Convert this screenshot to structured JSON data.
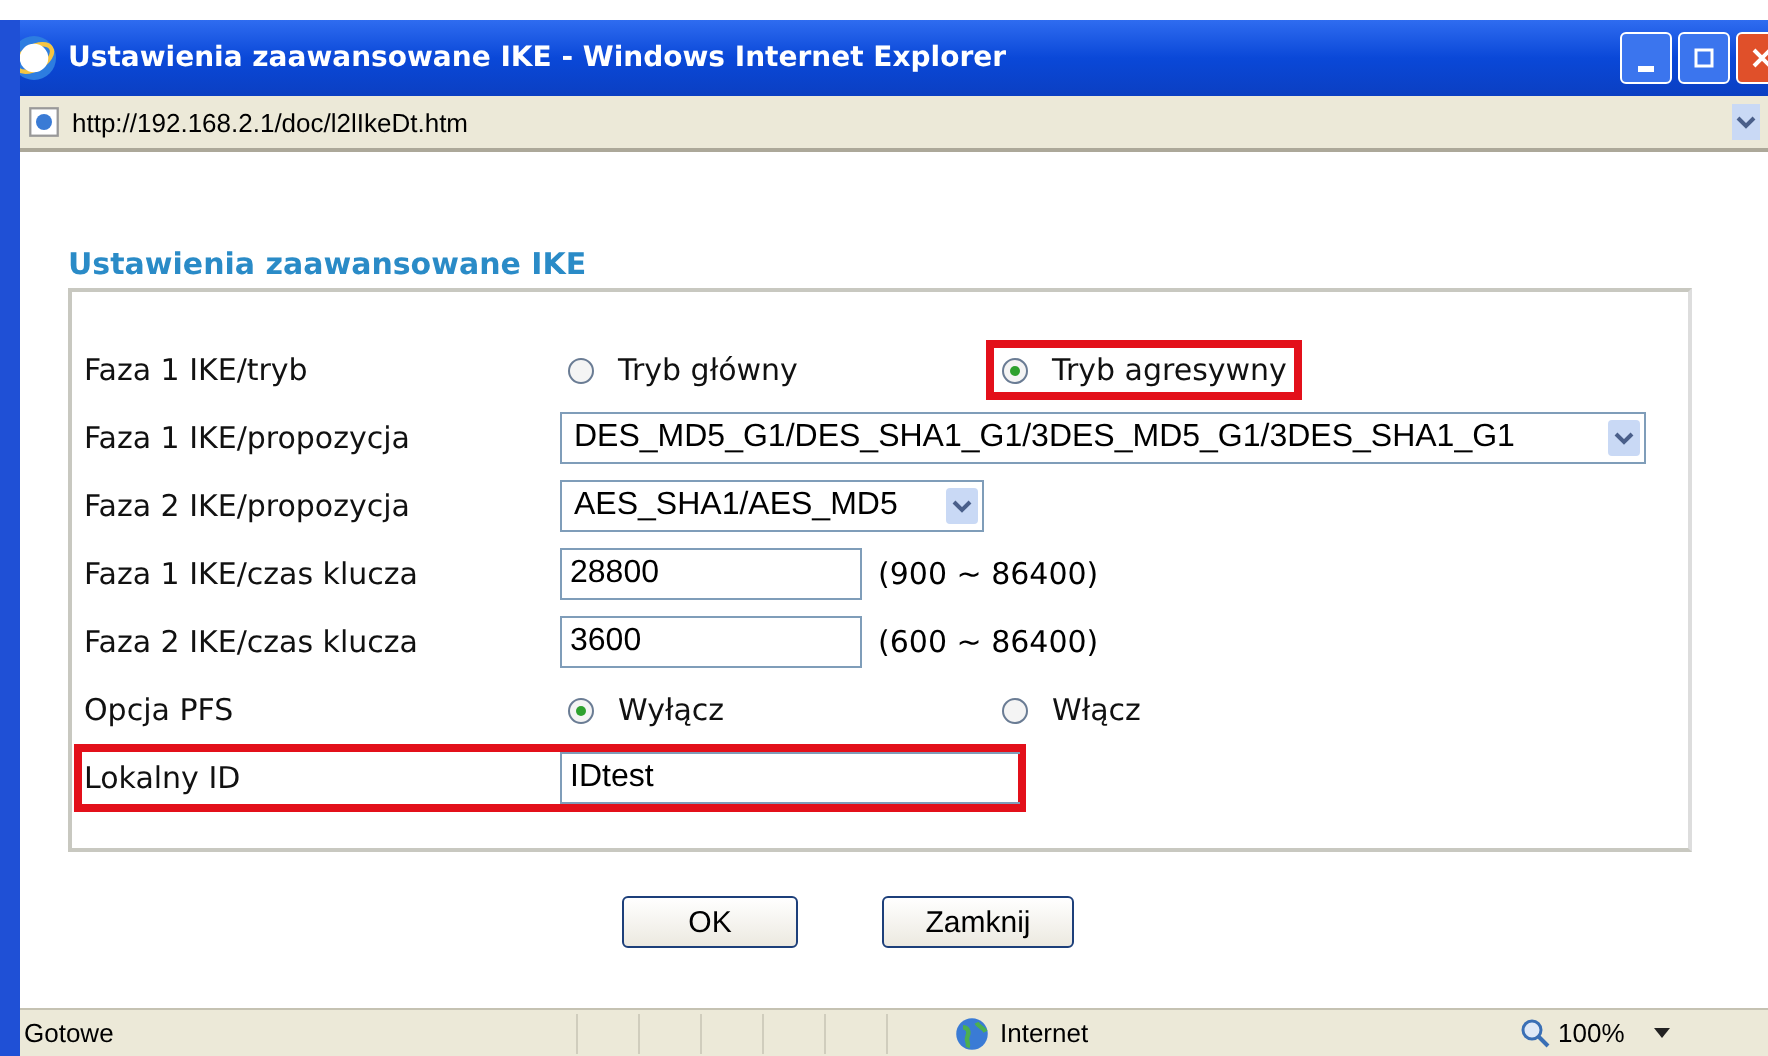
{
  "window": {
    "title": "Ustawienia zaawansowane IKE - Windows Internet Explorer"
  },
  "address_bar": {
    "url": "http://192.168.2.1/doc/l2lIkeDt.htm"
  },
  "section_title": "Ustawienia zaawansowane IKE",
  "rows": [
    {
      "kind": "radio",
      "label": "Faza 1 IKE/tryb",
      "highlighted": false,
      "options": [
        {
          "label": "Tryb główny",
          "selected": false,
          "highlighted": false
        },
        {
          "label": "Tryb agresywny",
          "selected": true,
          "highlighted": true
        }
      ]
    },
    {
      "kind": "select",
      "label": "Faza 1 IKE/propozycja",
      "highlighted": false,
      "value": "DES_MD5_G1/DES_SHA1_G1/3DES_MD5_G1/3DES_SHA1_G1",
      "wide": true
    },
    {
      "kind": "select",
      "label": "Faza 2 IKE/propozycja",
      "highlighted": false,
      "value": "AES_SHA1/AES_MD5",
      "wide": false
    },
    {
      "kind": "text",
      "label": "Faza 1 IKE/czas klucza",
      "highlighted": false,
      "value": "28800",
      "range": "(900 ~ 86400)"
    },
    {
      "kind": "text",
      "label": "Faza 2 IKE/czas klucza",
      "highlighted": false,
      "value": "3600",
      "range": "(600 ~ 86400)"
    },
    {
      "kind": "radio",
      "label": "Opcja PFS",
      "highlighted": false,
      "options": [
        {
          "label": "Wyłącz",
          "selected": true,
          "highlighted": false
        },
        {
          "label": "Włącz",
          "selected": false,
          "highlighted": false
        }
      ]
    },
    {
      "kind": "text",
      "label": "Lokalny ID",
      "highlighted": true,
      "value": "IDtest"
    }
  ],
  "buttons": [
    "OK",
    "Zamknij"
  ],
  "status_bar": {
    "text": "Gotowe",
    "zone": "Internet",
    "zoom": "100%"
  }
}
